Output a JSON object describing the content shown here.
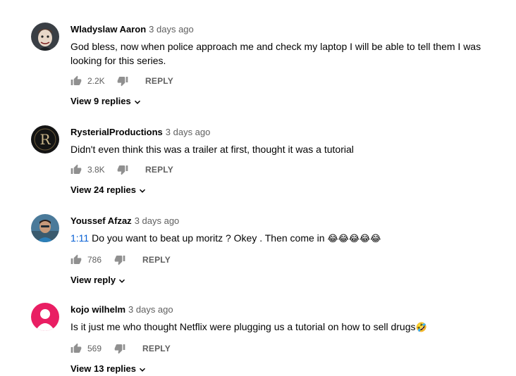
{
  "comments": [
    {
      "author": "Wladyslaw Aaron",
      "time": "3 days ago",
      "text": "God bless, now when police approach me and check my laptop I will be able to tell them I was looking for this series.",
      "likes": "2.2K",
      "reply_label": "REPLY",
      "view_replies": "View 9 replies",
      "avatar_icon": "portrait-avatar-icon"
    },
    {
      "author": "RysterialProductions",
      "time": "3 days ago",
      "text": "Didn't even think this was a trailer at first, thought it was a tutorial",
      "likes": "3.8K",
      "reply_label": "REPLY",
      "view_replies": "View 24 replies",
      "avatar_icon": "letter-r-logo-avatar-icon"
    },
    {
      "author": "Youssef Afzaz",
      "time": "3 days ago",
      "timestamp_link": "1:11",
      "text": " Do you want to beat up moritz ? Okey . Then come in ",
      "emojis": "😂😂😂😂😂",
      "likes": "786",
      "reply_label": "REPLY",
      "view_replies": "View reply",
      "avatar_icon": "photo-avatar-icon"
    },
    {
      "author": "kojo wilhelm",
      "time": "3 days ago",
      "text": "Is it just me who thought Netflix were plugging us a tutorial on how to sell drugs",
      "emojis": "🤣",
      "likes": "569",
      "reply_label": "REPLY",
      "view_replies": "View 13 replies",
      "avatar_icon": "default-person-avatar-icon",
      "avatar_color": "#e91e63"
    }
  ],
  "icons": {
    "like": "thumbs-up-icon",
    "dislike": "thumbs-down-icon",
    "expand": "chevron-down-icon"
  }
}
